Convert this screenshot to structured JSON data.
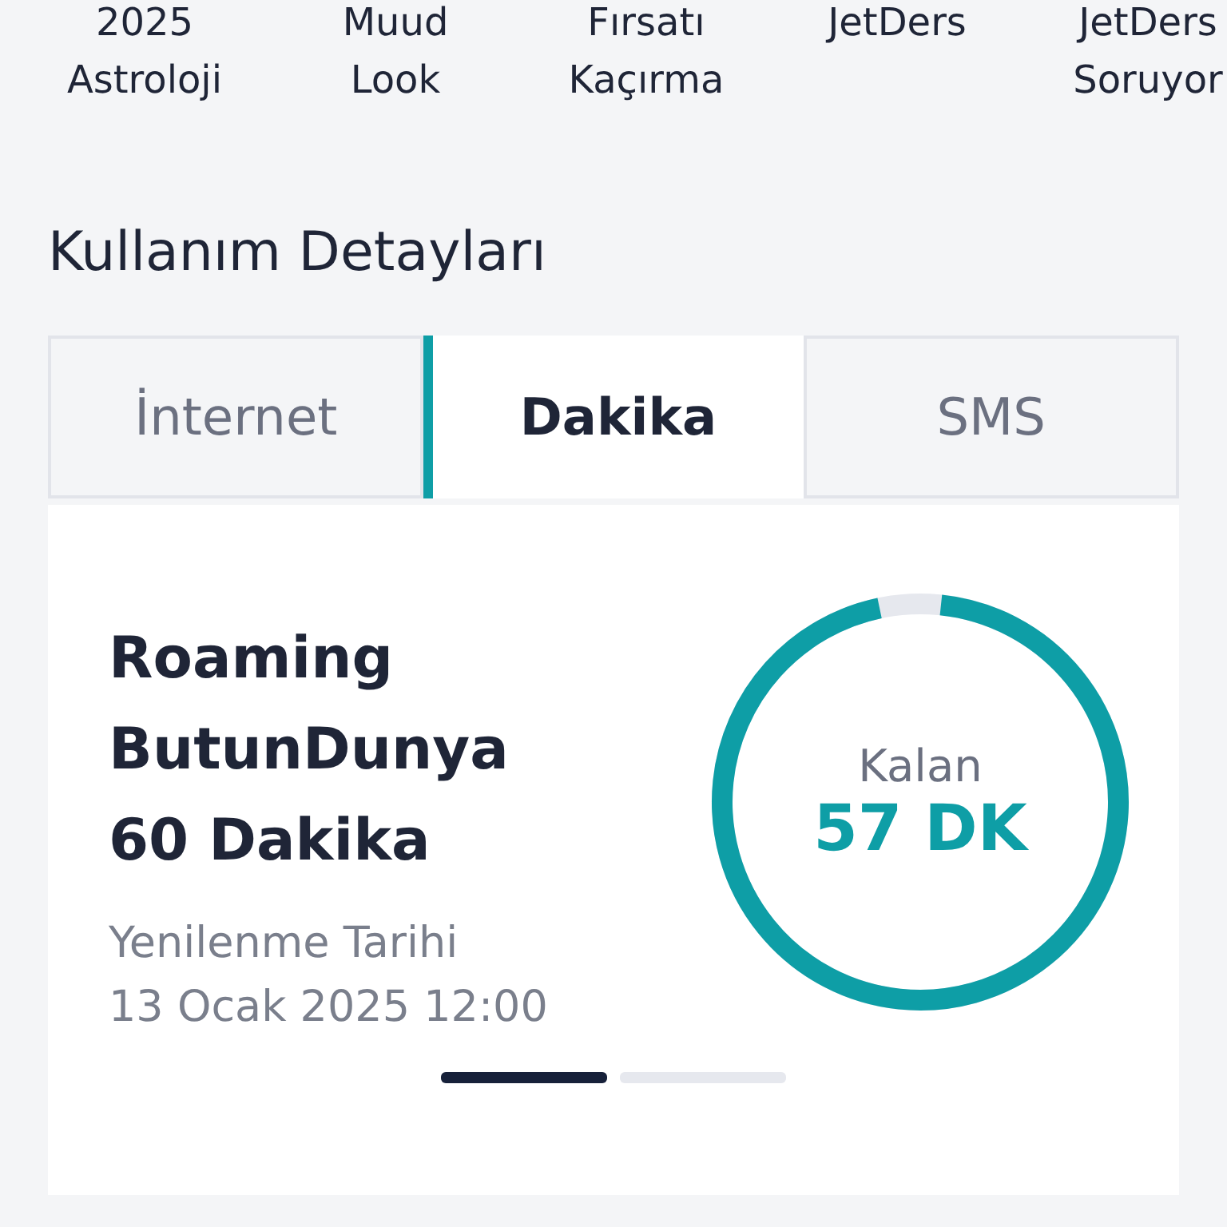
{
  "stories": [
    {
      "label": "2025\nAstroloji"
    },
    {
      "label": "Muud\nLook"
    },
    {
      "label": "Fırsatı\nKaçırma"
    },
    {
      "label": "JetDers"
    },
    {
      "label": "JetDers\nSoruyor"
    }
  ],
  "section_title": "Kullanım Detayları",
  "tabs": [
    {
      "label": "İnternet",
      "selected": false
    },
    {
      "label": "Dakika",
      "selected": true
    },
    {
      "label": "SMS",
      "selected": false
    }
  ],
  "package": {
    "title": "Roaming\nButunDunya\n60 Dakika",
    "renewal_label": "Yenilenme Tarihi",
    "renewal_date": "13 Ocak 2025 12:00",
    "gauge": {
      "label": "Kalan",
      "value": "57 DK",
      "level": 0.95
    }
  },
  "pager": [
    {
      "selected": true
    },
    {
      "selected": false
    }
  ]
}
